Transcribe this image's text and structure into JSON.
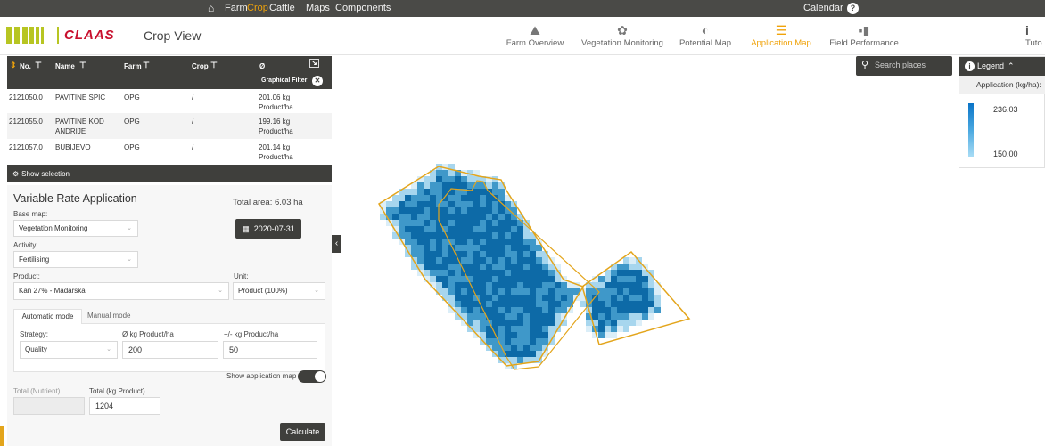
{
  "topnav": {
    "items": [
      "Farm",
      "Crop",
      "Cattle",
      "Maps",
      "Components"
    ],
    "active": "Crop",
    "calendar": "Calendar",
    "help": "?"
  },
  "header": {
    "brand": "CLAAS",
    "title": "Crop View",
    "tabs": [
      {
        "label": "Farm Overview",
        "icon": "tractor-icon"
      },
      {
        "label": "Vegetation Monitoring",
        "icon": "plant-icon"
      },
      {
        "label": "Potential Map",
        "icon": "gauge-icon"
      },
      {
        "label": "Application Map",
        "icon": "application-icon"
      },
      {
        "label": "Field Performance",
        "icon": "bar-chart-icon"
      },
      {
        "label": "Tuto",
        "icon": "info-icon"
      }
    ],
    "active_tab": "Application Map"
  },
  "fields_table": {
    "columns": [
      "No.",
      "Name",
      "Farm",
      "Crop",
      "Ø"
    ],
    "graphical_filter": "Graphical Filter",
    "rows": [
      {
        "no": "2121050.0",
        "name": "PAVITINE SPIC",
        "farm": "OPG",
        "crop": "/",
        "avg": "201.06 kg",
        "unit": "Product/ha"
      },
      {
        "no": "2121055.0",
        "name": "PAVITINE KOD",
        "name2": "ANDRIJE",
        "farm": "OPG",
        "crop": "/",
        "avg": "199.16 kg",
        "unit": "Product/ha"
      },
      {
        "no": "2121057.0",
        "name": "BUBIJEVO",
        "farm": "OPG",
        "crop": "/",
        "avg": "201.14 kg",
        "unit": "Product/ha"
      }
    ],
    "show_selection": "Show selection"
  },
  "vra": {
    "title": "Variable Rate Application",
    "total_area": "Total area: 6.03 ha",
    "base_map_label": "Base map:",
    "base_map": "Vegetation Monitoring",
    "date": "2020-07-31",
    "activity_label": "Activity:",
    "activity": "Fertilising",
    "product_label": "Product:",
    "product": "Kan 27% - Madarska",
    "unit_label": "Unit:",
    "unit": "Product (100%)",
    "tab_auto": "Automatic mode",
    "tab_manual": "Manual mode",
    "strategy_label": "Strategy:",
    "strategy": "Quality",
    "avg_label": "Ø kg Product/ha",
    "avg_value": "200",
    "pm_label": "+/- kg Product/ha",
    "pm_value": "50",
    "show_app_map": "Show application map",
    "show_app_map_on": true,
    "total_nutrient_label": "Total (Nutrient)",
    "total_nutrient": "",
    "total_product_label": "Total (kg Product)",
    "total_product": "1204",
    "calculate": "Calculate"
  },
  "map": {
    "search_placeholder": "Search places",
    "legend_title": "Legend",
    "legend_subtitle": "Application (kg/ha):",
    "legend_max": "236.03",
    "legend_min": "150.00",
    "colors": {
      "dark": "#0d6aa7",
      "mid": "#3f98c9",
      "light": "#a7d6ee",
      "pale": "#dbeef8",
      "boundary": "#e3a51c"
    }
  }
}
